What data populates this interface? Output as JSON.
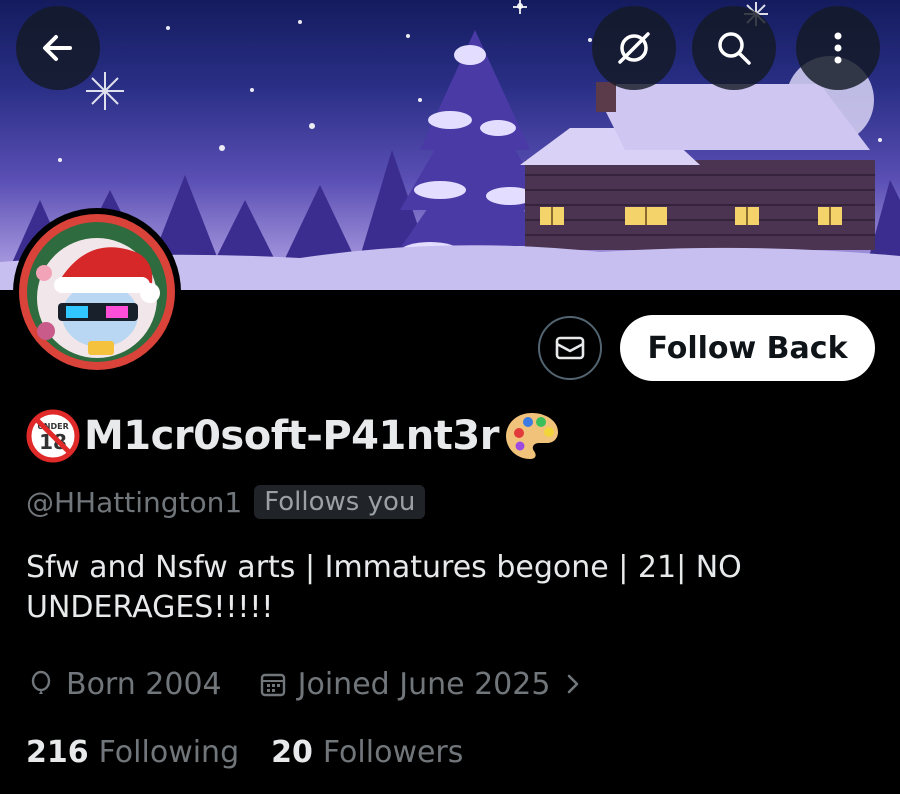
{
  "header": {
    "back_icon": "arrow-left-icon",
    "grok_icon": "grok-icon",
    "search_icon": "search-icon",
    "more_icon": "more-vertical-icon"
  },
  "actions": {
    "message_icon": "envelope-icon",
    "follow_label": "Follow Back"
  },
  "profile": {
    "badge_icon": "under-18-prohibited-emoji",
    "name": "M1cr0soft-P41nt3r",
    "trailing_emoji": "🎨",
    "handle": "@HHattington1",
    "follows_you": "Follows you",
    "bio": "Sfw and Nsfw arts | Immatures begone | 21| NO UNDERAGES!!!!!",
    "birth": "Born 2004",
    "joined": "Joined June 2025",
    "following_count": "216",
    "following_label": "Following",
    "followers_count": "20",
    "followers_label": "Followers"
  },
  "colors": {
    "background": "#000000",
    "primary_text": "#e7e9ea",
    "secondary_text": "#71767b",
    "follow_button_bg": "#ffffff",
    "banner_sky": "#2a2f86"
  }
}
